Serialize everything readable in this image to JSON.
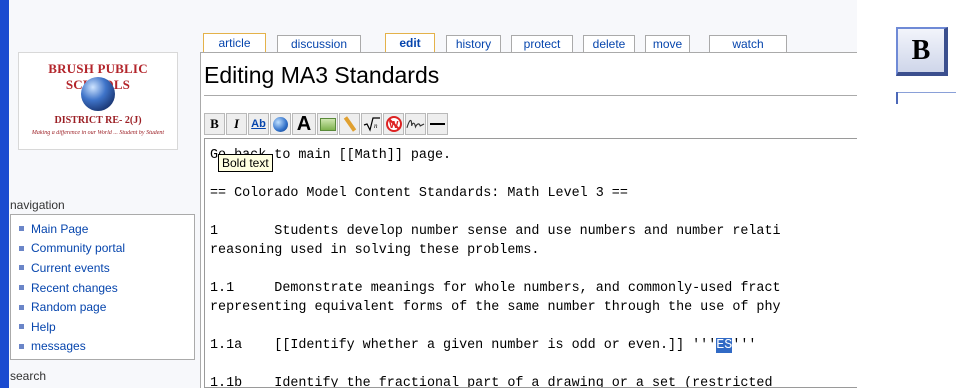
{
  "logo": {
    "line1": "BRUSH PUBLIC SCHOOLS",
    "line2": "DISTRICT RE- 2(J)",
    "line3": "Making a difference in our World ... Student by Student"
  },
  "navigation": {
    "heading": "navigation",
    "items": [
      "Main Page",
      "Community portal",
      "Current events",
      "Recent changes",
      "Random page",
      "Help",
      "messages"
    ]
  },
  "search_heading": "search",
  "tabs": [
    {
      "label": "article"
    },
    {
      "label": "discussion"
    },
    {
      "label": "edit"
    },
    {
      "label": "history"
    },
    {
      "label": "protect"
    },
    {
      "label": "delete"
    },
    {
      "label": "move"
    },
    {
      "label": "watch"
    }
  ],
  "page_title": "Editing MA3 Standards",
  "toolbar": {
    "bold": "B",
    "italic": "I",
    "link": "Ab",
    "heading": "A"
  },
  "tooltip": "Bold text",
  "editor": {
    "lines": [
      "Go back to main [[Math]] page.",
      "",
      "== Colorado Model Content Standards: Math Level 3 ==",
      "",
      "1       Students develop number sense and use numbers and number relati",
      "reasoning used in solving these problems.",
      "",
      "1.1     Demonstrate meanings for whole numbers, and commonly-used fract",
      "representing equivalent forms of the same number through the use of phy",
      "",
      "1.1a    [[Identify whether a given number is odd or even.]] '''",
      "",
      "1.1b    Identify the fractional part of a drawing or a set (restricted"
    ],
    "selected_text": "ES",
    "after_selected": "'''"
  },
  "big_button": "B"
}
